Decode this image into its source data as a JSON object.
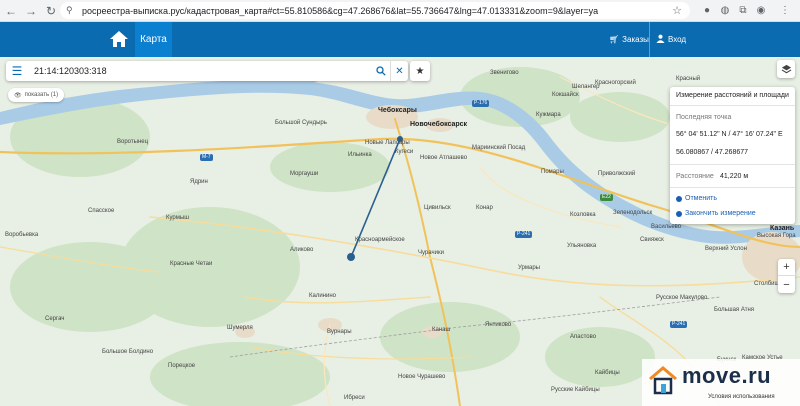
{
  "browser": {
    "url": "росреестра-выписка.рус/кадастровая_карта#ct=55.810586&cg=47.268676&lat=55.736647&lng=47.013331&zoom=9&layer=ya"
  },
  "header": {
    "tab_map": "Карта",
    "orders": "Заказы",
    "login": "Вход"
  },
  "search": {
    "value": "21:14:120303:318"
  },
  "show_button": "показать (1)",
  "measure": {
    "title": "Измерение расстояний и площади",
    "last_point_label": "Последняя точка",
    "coords_dms": "56° 04' 51.12\" N / 47° 16' 07.24\" E",
    "coords_dec": "56.080867 / 47.268677",
    "distance_label": "Расстояние",
    "distance_value": "41,220 м",
    "cancel": "Отменить",
    "finish": "Закончить измерение"
  },
  "zoom": {
    "in": "+",
    "out": "−"
  },
  "watermark": {
    "brand": "move.ru",
    "terms": "Условия использования"
  },
  "map": {
    "places": [
      {
        "name": "Чебоксары",
        "big": true
      },
      {
        "name": "Новочебоксарск",
        "big": true
      },
      {
        "name": "Казань",
        "big": true
      },
      {
        "name": "Большой Сундырь"
      },
      {
        "name": "Новые Лапсары"
      },
      {
        "name": "Ильинка"
      },
      {
        "name": "Мариинский Посад"
      },
      {
        "name": "Кугеси"
      },
      {
        "name": "Новое Атлашево"
      },
      {
        "name": "Моргауши"
      },
      {
        "name": "Цивильск"
      },
      {
        "name": "Конар"
      },
      {
        "name": "Аликово"
      },
      {
        "name": "Красноармейское"
      },
      {
        "name": "Чурачики"
      },
      {
        "name": "Калинино"
      },
      {
        "name": "Вурнары"
      },
      {
        "name": "Канаш"
      },
      {
        "name": "Янтиково"
      },
      {
        "name": "Шумерля"
      },
      {
        "name": "Порецкое"
      },
      {
        "name": "Ядрин"
      },
      {
        "name": "Красные Четаи"
      },
      {
        "name": "Урмары"
      },
      {
        "name": "Звенигово"
      },
      {
        "name": "Кокшайск"
      },
      {
        "name": "Шелангер"
      },
      {
        "name": "Красный"
      },
      {
        "name": "Красногорский"
      },
      {
        "name": "Кужмара"
      },
      {
        "name": "Помары"
      },
      {
        "name": "Приволжский"
      },
      {
        "name": "Козловка"
      },
      {
        "name": "Зеленодольск"
      },
      {
        "name": "Свияжск"
      },
      {
        "name": "Васильево"
      },
      {
        "name": "Верхний Услон"
      },
      {
        "name": "Воротынец"
      },
      {
        "name": "Сергач"
      },
      {
        "name": "Воробьевка"
      },
      {
        "name": "Спасское"
      },
      {
        "name": "Курмыш"
      },
      {
        "name": "Ибреси"
      },
      {
        "name": "Большое Болдино"
      },
      {
        "name": "Новое Чурашево"
      },
      {
        "name": "Русские Кайбицы"
      },
      {
        "name": "Кайбицы"
      },
      {
        "name": "Большая Атня"
      },
      {
        "name": "Буинск"
      },
      {
        "name": "Камское Устье"
      },
      {
        "name": "Столбище"
      },
      {
        "name": "Высокая Гора"
      },
      {
        "name": "Русское Макулово"
      },
      {
        "name": "Ульяновка"
      },
      {
        "name": "Апастово"
      },
      {
        "name": "Ядрино"
      },
      {
        "name": "Ибреси"
      }
    ]
  }
}
